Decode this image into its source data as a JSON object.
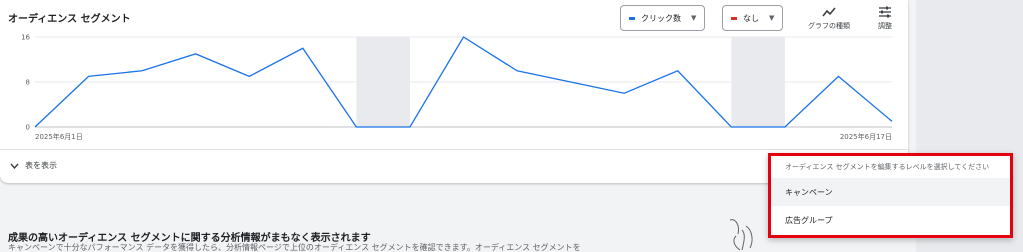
{
  "card": {
    "title": "オーディエンス セグメント",
    "metric1": {
      "label": "クリック数",
      "color": "#1a73e8"
    },
    "metric2": {
      "label": "なし",
      "color": "#d93025"
    },
    "chart_type_label": "グラフの種類",
    "adjust_label": "調整",
    "toggle_table_label": "表を表示"
  },
  "chart_data": {
    "type": "line",
    "x_start_label": "2025年6月1日",
    "x_end_label": "2025年6月17日",
    "yticks": [
      0,
      8,
      16
    ],
    "ylim": [
      0,
      16
    ],
    "series": [
      {
        "color": "#1a73e8",
        "values": [
          0,
          9,
          10,
          13,
          9,
          14,
          0,
          0,
          16,
          10,
          8,
          6,
          10,
          0,
          0,
          9,
          1
        ]
      }
    ],
    "shaded_days": [
      6,
      13
    ]
  },
  "dropdown": {
    "hint": "オーディエンス セグメントを編集するレベルを選択してください",
    "options": [
      "キャンペーン",
      "広告グループ"
    ]
  },
  "promo": {
    "title": "成果の高いオーディエンス セグメントに関する分析情報がまもなく表示されます",
    "body": "キャンペーンで十分なパフォーマンス データを獲得したら、分析情報ページで上位のオーディエンス セグメントを確認できます。オーディエンス セグメントを"
  }
}
